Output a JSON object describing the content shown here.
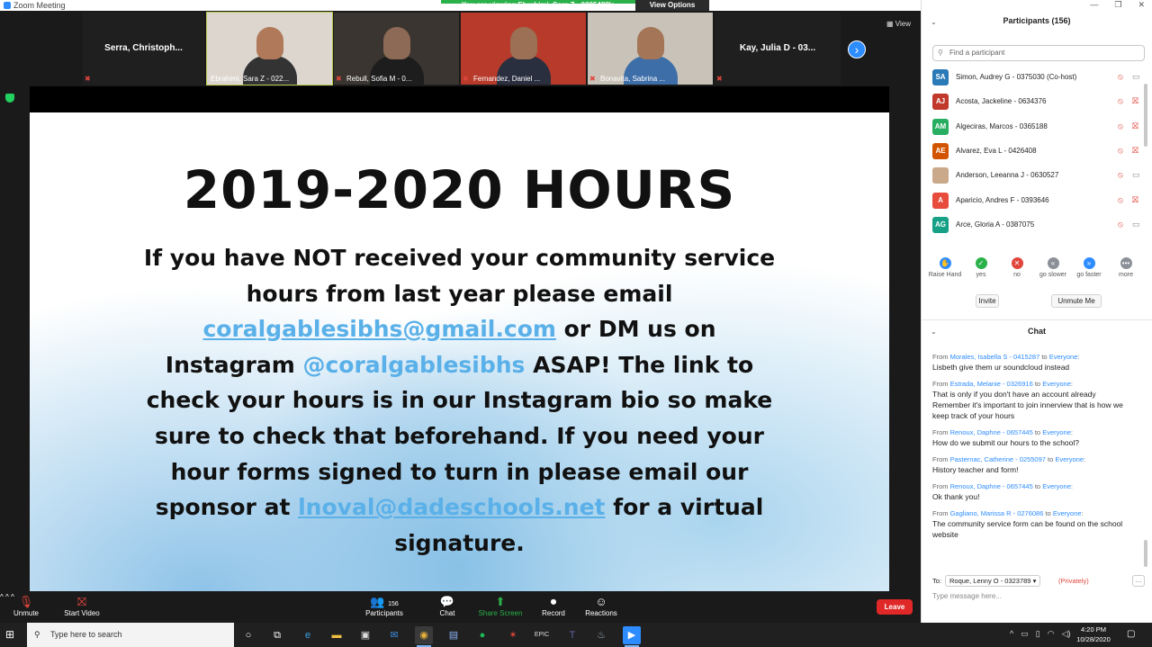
{
  "window": {
    "title": "Zoom Meeting"
  },
  "banner": {
    "message": "You are viewing Ebrahimi, Sara Z - 0225488's screen",
    "options": "View Options"
  },
  "view_label": "View",
  "thumbnails": [
    {
      "name": "Serra,  Christoph...",
      "video": false
    },
    {
      "name": "Ebrahimi, Sara Z - 022...",
      "video": true
    },
    {
      "name": "Rebull, Sofia M - 0...",
      "video": true
    },
    {
      "name": "Fernandez, Daniel ...",
      "video": true
    },
    {
      "name": "Bonavita, Sabrina ...",
      "video": true
    },
    {
      "name": "Kay, Julia D - 03...",
      "video": false
    }
  ],
  "slide": {
    "title": "2019-2020 HOURS",
    "p1": "If you have NOT received your community service hours from last year please email ",
    "email1": "coralgablesibhs@gmail.com",
    "p2": " or DM us on Instagram ",
    "handle": "@coralgablesibhs",
    "p3": " ASAP! The link to check your hours is in our Instagram bio so make sure to check that beforehand. If you need your hour forms signed to turn in please email our sponsor at ",
    "email2": "lnoval@dadeschools.net",
    "p4": " for a virtual signature."
  },
  "toolbar": {
    "unmute": "Unmute",
    "start_video": "Start Video",
    "participants": "Participants",
    "participant_count": "156",
    "chat": "Chat",
    "share_screen": "Share Screen",
    "record": "Record",
    "reactions": "Reactions",
    "leave": "Leave"
  },
  "participants_panel": {
    "header": "Participants (156)",
    "search_placeholder": "Find a participant",
    "list": [
      {
        "initials": "SA",
        "name": "Simon, Audrey G - 0375030 (Co-host)",
        "color": "#2b7ab8",
        "cam_on": true
      },
      {
        "initials": "AJ",
        "name": "Acosta, Jackeline - 0634376",
        "color": "#c0392b",
        "cam_on": false
      },
      {
        "initials": "AM",
        "name": "Algeciras, Marcos - 0365188",
        "color": "#27ae60",
        "cam_on": false
      },
      {
        "initials": "AE",
        "name": "Alvarez, Eva L - 0426408",
        "color": "#d35400",
        "cam_on": false
      },
      {
        "initials": "",
        "name": "Anderson, Leeanna J - 0630527",
        "color": "#c9a98a",
        "cam_on": true
      },
      {
        "initials": "A",
        "name": "Aparicio, Andres F - 0393646",
        "color": "#e74c3c",
        "cam_on": false
      },
      {
        "initials": "AG",
        "name": "Arce, Gloria A - 0387075",
        "color": "#16a085",
        "cam_on": true
      }
    ],
    "reactions": [
      {
        "label": "Raise Hand",
        "color": "#2d8cff",
        "glyph": "✋"
      },
      {
        "label": "yes",
        "color": "#2bb14a",
        "glyph": "✓"
      },
      {
        "label": "no",
        "color": "#e0463c",
        "glyph": "✕"
      },
      {
        "label": "go slower",
        "color": "#8a8f98",
        "glyph": "«"
      },
      {
        "label": "go faster",
        "color": "#2d8cff",
        "glyph": "»"
      },
      {
        "label": "more",
        "color": "#8a8f98",
        "glyph": "•••"
      }
    ],
    "invite": "Invite",
    "unmute_me": "Unmute Me"
  },
  "chat_panel": {
    "header": "Chat",
    "messages": [
      {
        "from": "Morales, Isabella S - 0415287",
        "to": "Everyone",
        "text": "Lisbeth give them ur soundcloud instead"
      },
      {
        "from": "Estrada, Melanie - 0326916",
        "to": "Everyone",
        "text": "That is only if you don't have an account already\nRemember it's important to join innerview that is how we keep track of your hours"
      },
      {
        "from": "Renoux, Daphne - 0657445",
        "to": "Everyone",
        "text": "How do we submit our hours to the school?"
      },
      {
        "from": "Pasternac, Catherine - 0255097",
        "to": "Everyone",
        "text": "History teacher and form!"
      },
      {
        "from": "Renoux, Daphne - 0657445",
        "to": "Everyone",
        "text": "Ok thank you!"
      },
      {
        "from": "Gagliano, Marissa R - 0276086",
        "to": "Everyone",
        "text": "The community service form can be found on the school website"
      }
    ],
    "from_word": "From",
    "to_word": "to",
    "to_label": "To:",
    "recipient": "Roque, Lenny O - 0323789",
    "privately": "(Privately)",
    "input_placeholder": "Type message here..."
  },
  "taskbar": {
    "search_placeholder": "Type here to search",
    "time": "4:20 PM",
    "date": "10/28/2020"
  }
}
